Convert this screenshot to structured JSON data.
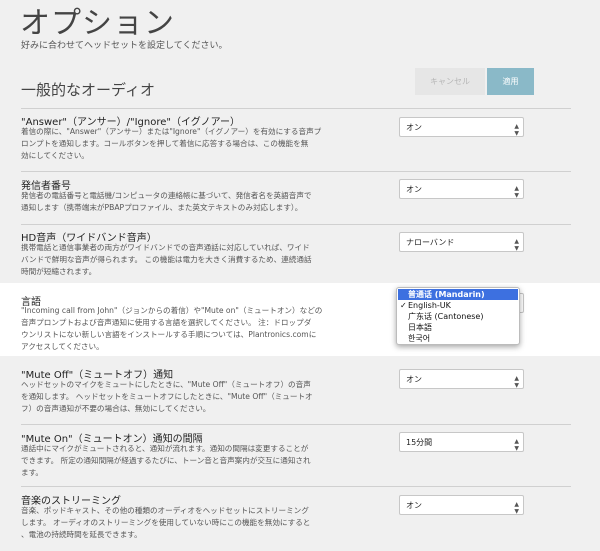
{
  "page": {
    "title": "オプション",
    "subtitle": "好みに合わせてヘッドセットを設定してください。"
  },
  "section": {
    "title": "一般的なオーディオ",
    "cancel_label": "キャンセル",
    "apply_label": "適用"
  },
  "settings": [
    {
      "title": "\"Answer\"（アンサー）/\"Ignore\"（イグノアー）",
      "desc": [
        "着信の際に、\"Answer\"（アンサー）または\"Ignore\"（イグノアー）を有効にする音声プ",
        "ロンプトを通知します。コールボタンを押して着信に応答する場合は、この機能を無",
        "効にしてください。"
      ],
      "value": "オン"
    },
    {
      "title": "発信者番号",
      "desc": [
        "発信者の電話番号と電話機/コンピュータの連絡帳に基づいて、発信者名を英語音声で",
        "通知します（携帯端末がPBAPプロファイル、また英文テキストのみ対応します）。"
      ],
      "value": "オン"
    },
    {
      "title": "HD音声（ワイドバンド音声）",
      "desc": [
        "携帯電話と通信事業者の両方がワイドバンドでの音声通話に対応していれば、ワイド",
        "バンドで鮮明な音声が得られます。 この機能は電力を大きく消費するため、連続通話",
        "時間が短縮されます。"
      ],
      "value": "ナローバンド"
    },
    {
      "title": "言語",
      "desc": [
        "\"Incoming call from John\"（ジョンからの着信）や\"Mute on\"（ミュートオン）などの",
        "音声プロンプトおよび音声通知に使用する言語を選択してください。 注：ドロップダ",
        "ウンリストにない新しい言語をインストールする手順については、Plantronics.comに",
        "アクセスしてください。"
      ],
      "value": ""
    },
    {
      "title": "\"Mute Off\"（ミュートオフ）通知",
      "desc": [
        "ヘッドセットのマイクをミュートにしたときに、\"Mute Off\"（ミュートオフ）の音声",
        "を通知します。 ヘッドセットをミュートオフにしたときに、\"Mute Off\"（ミュートオ",
        "フ）の音声通知が不要の場合は、無効にしてください。"
      ],
      "value": "オン"
    },
    {
      "title": "\"Mute On\"（ミュートオン）通知の間隔",
      "desc": [
        "通話中にマイクがミュートされると、通知が流れます。通知の間隔は変更することが",
        "できます。 所定の通知間隔が経過するたびに、トーン音と音声案内が交互に通知され",
        "ます。"
      ],
      "value": "15分間"
    },
    {
      "title": "音楽のストリーミング",
      "desc": [
        "音楽、ポッドキャスト、その他の種類のオーディオをヘッドセットにストリーミング",
        "します。 オーディオのストリーミングを使用していない時にこの機能を無効にすると",
        "、電池の持続時間を延長できます。"
      ],
      "value": "オン"
    }
  ],
  "language_dropdown": {
    "options": [
      "普通话 (Mandarin)",
      "English-UK",
      "广东话 (Cantonese)",
      "日本語",
      "한국어"
    ],
    "highlighted_index": 0,
    "checked_index": 1,
    "check_mark": "✓"
  },
  "icons": {
    "select_arrow": "chevron-updown-icon",
    "check": "checkmark-icon"
  },
  "colors": {
    "apply_button": "#8ab9c8",
    "highlight": "#3d70e0",
    "background": "#f0f0f0"
  }
}
